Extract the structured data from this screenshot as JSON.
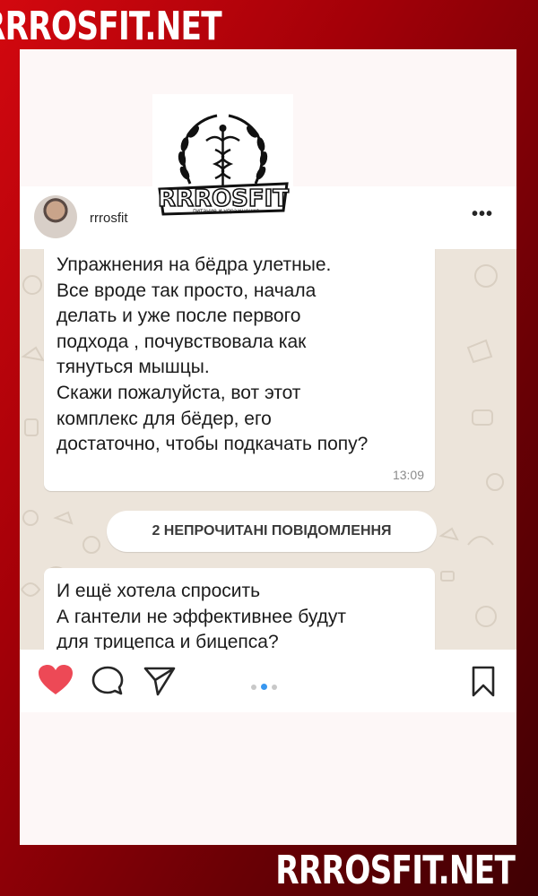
{
  "site": {
    "brand_top": "RRROSFIT.NET",
    "brand_bottom": "RRROSFIT.NET"
  },
  "logo": {
    "text": "RRROSFIT",
    "tagline": "питание и упражнения"
  },
  "post": {
    "username": "rrrosfit",
    "more_icon": "more-horizontal-icon"
  },
  "chat": {
    "message1": {
      "text": "Упражнения на бёдра улетные.\nВсе вроде так просто, начала\nделать и уже после первого\nподхода , почувствовала как\nтянуться мышцы.\nСкажи пожалуйста, вот этот\nкомплекс для бёдер, его\nдостаточно, чтобы подкачать попу?",
      "time": "13:09"
    },
    "unread_label": "2 НЕПРОЧИТАНІ ПОВІДОМЛЕННЯ",
    "message2": {
      "text": "И ещё хотела спросить\nА гантели не эффективнее будут\nдля трицепса и бицепса?"
    }
  },
  "actions": {
    "like_icon": "heart-icon",
    "like_color": "#ed4956",
    "comment_icon": "comment-icon",
    "share_icon": "send-icon",
    "save_icon": "bookmark-icon",
    "carousel": {
      "count": 3,
      "active": 2
    },
    "accent_color": "#3897f0"
  },
  "colors": {
    "background": "#a30008",
    "chat_bg": "#ece4da"
  }
}
